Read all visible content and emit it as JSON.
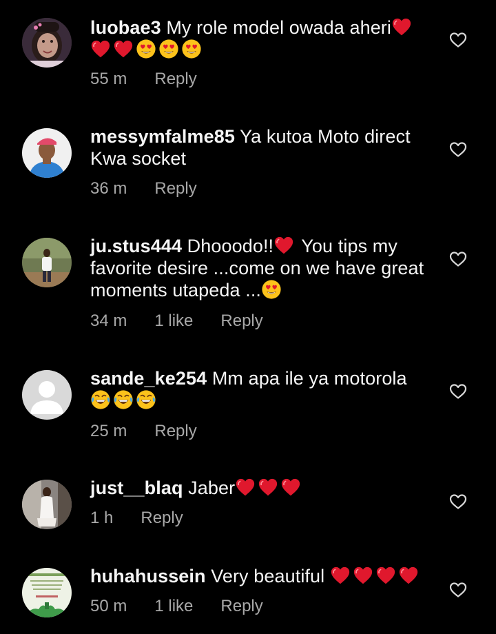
{
  "icons": {
    "like": "heart-outline-icon",
    "red_heart": "red-heart-emoji",
    "heart_eyes": "heart-eyes-emoji",
    "tears_of_joy": "face-with-tears-of-joy-emoji"
  },
  "colors": {
    "background": "#000000",
    "text": "#f5f5f5",
    "meta": "#a8a8a8",
    "heart_red": "#e0182d",
    "emoji_yellow": "#fcc21b"
  },
  "comments": [
    {
      "username": "luobae3",
      "text": " My role model owada aheri",
      "emojis": [
        "red-heart",
        "red-heart",
        "red-heart",
        "heart-eyes",
        "heart-eyes",
        "heart-eyes"
      ],
      "time": "55 m",
      "likes": "",
      "reply": "Reply"
    },
    {
      "username": "messymfalme85",
      "text": " Ya kutoa Moto direct Kwa socket",
      "emojis": [],
      "time": "36 m",
      "likes": "",
      "reply": "Reply"
    },
    {
      "username": "ju.stus444",
      "text": " Dhooodo!!",
      "text_after_heart": " You tips my favorite desire ...come on we have great moments utapeda ...",
      "emojis": [
        "heart-eyes"
      ],
      "time": "34 m",
      "likes": "1 like",
      "reply": "Reply"
    },
    {
      "username": "sande_ke254",
      "text": " Mm apa ile ya motorola",
      "emojis": [
        "tears-of-joy",
        "tears-of-joy",
        "tears-of-joy"
      ],
      "time": "25 m",
      "likes": "",
      "reply": "Reply"
    },
    {
      "username": "just__blaq",
      "text": " Jaber",
      "emojis": [
        "red-heart",
        "red-heart",
        "red-heart"
      ],
      "time": "1 h",
      "likes": "",
      "reply": "Reply"
    },
    {
      "username": "huhahussein",
      "text": " Very beautiful ",
      "emojis": [
        "red-heart",
        "red-heart",
        "red-heart",
        "red-heart"
      ],
      "time": "50 m",
      "likes": "1 like",
      "reply": "Reply"
    }
  ]
}
